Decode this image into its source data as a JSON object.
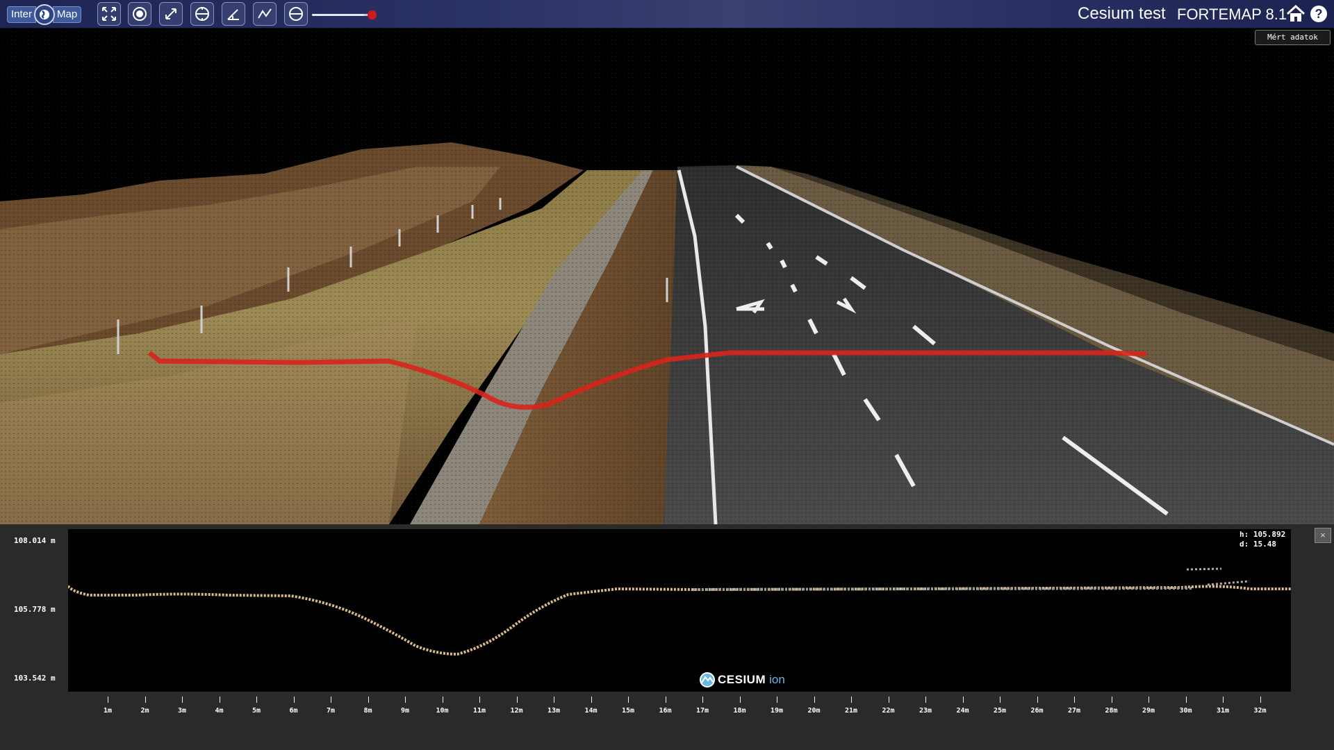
{
  "toolbar": {
    "mode_left": "Inter",
    "mode_right": "Map",
    "tools": [
      {
        "name": "fit-extent-icon"
      },
      {
        "name": "point-target-icon"
      },
      {
        "name": "distance-measure-icon"
      },
      {
        "name": "area-measure-icon"
      },
      {
        "name": "angle-measure-icon"
      },
      {
        "name": "profile-line-icon"
      },
      {
        "name": "cross-section-icon"
      }
    ],
    "slider_level": 0.85,
    "title": "Cesium test",
    "version": "FORTEMAP 8.1",
    "help_label": "?",
    "measured_data_label": "Mért adatok"
  },
  "profile": {
    "y_labels": [
      "108.014 m",
      "105.778 m",
      "103.542 m"
    ],
    "y_range": [
      103.542,
      108.014
    ],
    "readout_h": "h: 105.892",
    "readout_d": "d: 15.48",
    "close_label": "×",
    "x_ticks": [
      "1m",
      "2m",
      "3m",
      "4m",
      "5m",
      "6m",
      "7m",
      "8m",
      "9m",
      "10m",
      "11m",
      "12m",
      "13m",
      "14m",
      "15m",
      "16m",
      "17m",
      "18m",
      "19m",
      "20m",
      "21m",
      "22m",
      "23m",
      "24m",
      "25m",
      "26m",
      "27m",
      "28m",
      "29m",
      "30m",
      "31m",
      "32m"
    ],
    "logo_word": "CESIUM",
    "logo_suffix": "ion"
  },
  "colors": {
    "profile_line": "#d8231c",
    "ground_points": "#d9b98a",
    "road_points": "#9a9a9a"
  }
}
